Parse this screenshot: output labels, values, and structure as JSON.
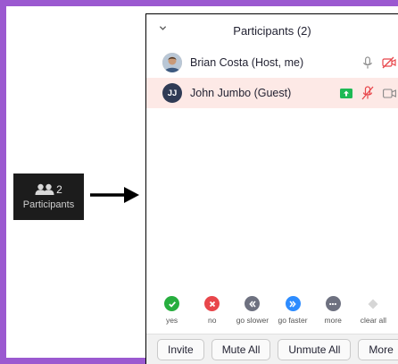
{
  "toolbar": {
    "participants_count": "2",
    "participants_label": "Participants"
  },
  "panel": {
    "title": "Participants (2)",
    "participants": [
      {
        "name": "Brian Costa (Host, me)",
        "avatar": "photo"
      },
      {
        "name": "John Jumbo (Guest)",
        "initials": "JJ"
      }
    ]
  },
  "reactions": [
    {
      "label": "yes",
      "icon": "check-icon",
      "color": "#27ae3e"
    },
    {
      "label": "no",
      "icon": "x-icon",
      "color": "#e8464b"
    },
    {
      "label": "go slower",
      "icon": "rewind-icon",
      "color": "#6e7180"
    },
    {
      "label": "go faster",
      "icon": "fast-forward-icon",
      "color": "#2d8cff"
    },
    {
      "label": "more",
      "icon": "ellipsis-icon",
      "color": "#6e7180"
    },
    {
      "label": "clear all",
      "icon": "eraser-icon",
      "color": "#c9c9c9"
    }
  ],
  "bottombar": {
    "invite": "Invite",
    "mute_all": "Mute All",
    "unmute_all": "Unmute All",
    "more": "More"
  },
  "colors": {
    "frame": "#9b59d0",
    "highlight_row": "#fde9e6",
    "muted_red": "#e8464b",
    "share_green": "#1db954"
  }
}
